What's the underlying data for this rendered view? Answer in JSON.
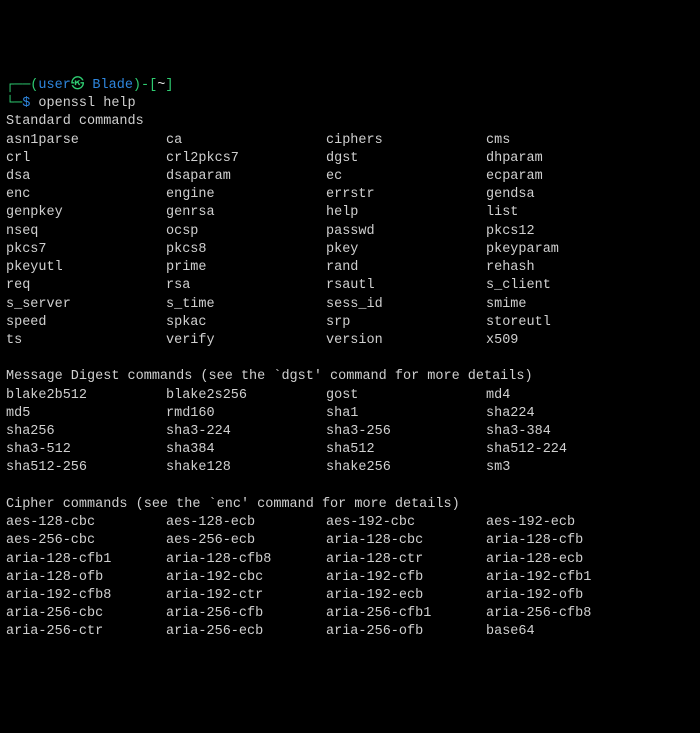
{
  "prompt": {
    "open": "┌──(",
    "user": "user",
    "at": "㉿",
    "host": " Blade",
    "close": ")-[",
    "path": "~",
    "close2": "]",
    "line2_prefix": "└─",
    "dollar": "$ ",
    "command": "openssl help"
  },
  "sections": [
    {
      "title": "Standard commands",
      "rows": [
        [
          "asn1parse",
          "ca",
          "ciphers",
          "cms"
        ],
        [
          "crl",
          "crl2pkcs7",
          "dgst",
          "dhparam"
        ],
        [
          "dsa",
          "dsaparam",
          "ec",
          "ecparam"
        ],
        [
          "enc",
          "engine",
          "errstr",
          "gendsa"
        ],
        [
          "genpkey",
          "genrsa",
          "help",
          "list"
        ],
        [
          "nseq",
          "ocsp",
          "passwd",
          "pkcs12"
        ],
        [
          "pkcs7",
          "pkcs8",
          "pkey",
          "pkeyparam"
        ],
        [
          "pkeyutl",
          "prime",
          "rand",
          "rehash"
        ],
        [
          "req",
          "rsa",
          "rsautl",
          "s_client"
        ],
        [
          "s_server",
          "s_time",
          "sess_id",
          "smime"
        ],
        [
          "speed",
          "spkac",
          "srp",
          "storeutl"
        ],
        [
          "ts",
          "verify",
          "version",
          "x509"
        ]
      ]
    },
    {
      "title": "Message Digest commands (see the `dgst' command for more details)",
      "rows": [
        [
          "blake2b512",
          "blake2s256",
          "gost",
          "md4"
        ],
        [
          "md5",
          "rmd160",
          "sha1",
          "sha224"
        ],
        [
          "sha256",
          "sha3-224",
          "sha3-256",
          "sha3-384"
        ],
        [
          "sha3-512",
          "sha384",
          "sha512",
          "sha512-224"
        ],
        [
          "sha512-256",
          "shake128",
          "shake256",
          "sm3"
        ]
      ]
    },
    {
      "title": "Cipher commands (see the `enc' command for more details)",
      "rows": [
        [
          "aes-128-cbc",
          "aes-128-ecb",
          "aes-192-cbc",
          "aes-192-ecb"
        ],
        [
          "aes-256-cbc",
          "aes-256-ecb",
          "aria-128-cbc",
          "aria-128-cfb"
        ],
        [
          "aria-128-cfb1",
          "aria-128-cfb8",
          "aria-128-ctr",
          "aria-128-ecb"
        ],
        [
          "aria-128-ofb",
          "aria-192-cbc",
          "aria-192-cfb",
          "aria-192-cfb1"
        ],
        [
          "aria-192-cfb8",
          "aria-192-ctr",
          "aria-192-ecb",
          "aria-192-ofb"
        ],
        [
          "aria-256-cbc",
          "aria-256-cfb",
          "aria-256-cfb1",
          "aria-256-cfb8"
        ],
        [
          "aria-256-ctr",
          "aria-256-ecb",
          "aria-256-ofb",
          "base64"
        ]
      ]
    }
  ]
}
